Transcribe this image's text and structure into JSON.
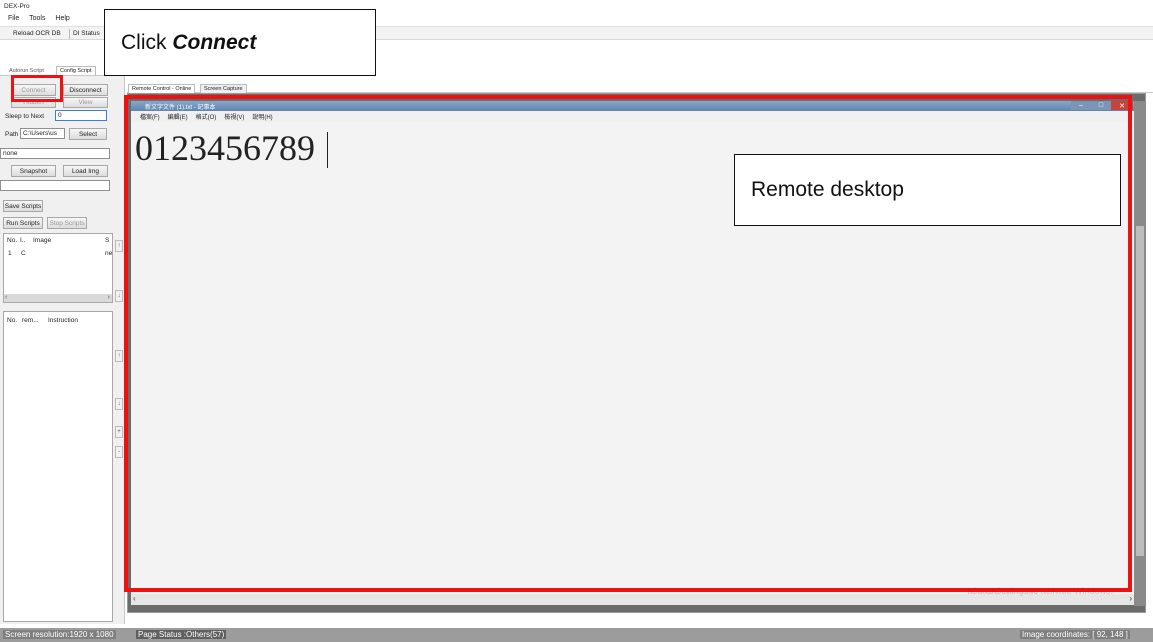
{
  "app": {
    "title": "DEX-Pro",
    "menu": [
      "File",
      "Tools",
      "Help"
    ],
    "toolbar": [
      "Reload OCR DB",
      "DI Status"
    ]
  },
  "left_panel": {
    "tabs": [
      "Autorun Script",
      "Config Script"
    ],
    "connect_label": "Connect",
    "disconnect_label": "Disconnect",
    "hidden_label": "Hidden",
    "view_label": "View",
    "sleep_label": "Sleep to Next",
    "sleep_value": "0",
    "path_label": "Path",
    "path_value": "C:\\Users\\us",
    "select_label": "Select",
    "none_value": "none",
    "snapshot_label": "Snapshot",
    "load_img_label": "Load Img",
    "save_scripts_label": "Save Scripts",
    "run_scripts_label": "Run Scripts",
    "stop_scripts_label": "Stop Scripts",
    "image_table": {
      "headers": [
        "No.",
        "I..",
        "Image",
        "S"
      ],
      "rows": [
        [
          "1",
          "C",
          "",
          "ne"
        ]
      ]
    },
    "instruction_table": {
      "headers": [
        "No.",
        "rem...",
        "Instruction"
      ]
    }
  },
  "main": {
    "tabs": [
      "Remote Control - Online",
      "Screen Capture"
    ],
    "notepad": {
      "title": "新文字文件 (1).txt - 記事本",
      "menu": [
        "檔案(F)",
        "編輯(E)",
        "格式(O)",
        "檢視(V)",
        "說明(H)"
      ],
      "content": "0123456789"
    },
    "watermark_line1": "Activate Windows",
    "watermark_line2": "Go to Settings to activate Windows."
  },
  "callouts": {
    "click_prefix": "Click ",
    "click_emph": "Connect",
    "remote_desktop": "Remote desktop"
  },
  "status_bar": {
    "resolution": "Screen resolution:1920 x 1080",
    "page_status": "Page Status :Others(57)",
    "image_coords": "Image coordinates: [ 92, 148 ]"
  },
  "colors": {
    "highlight_red": "#ee1111",
    "status_bar_bg": "#9c9c9c",
    "notepad_titlebar": "#6e8fb6"
  }
}
